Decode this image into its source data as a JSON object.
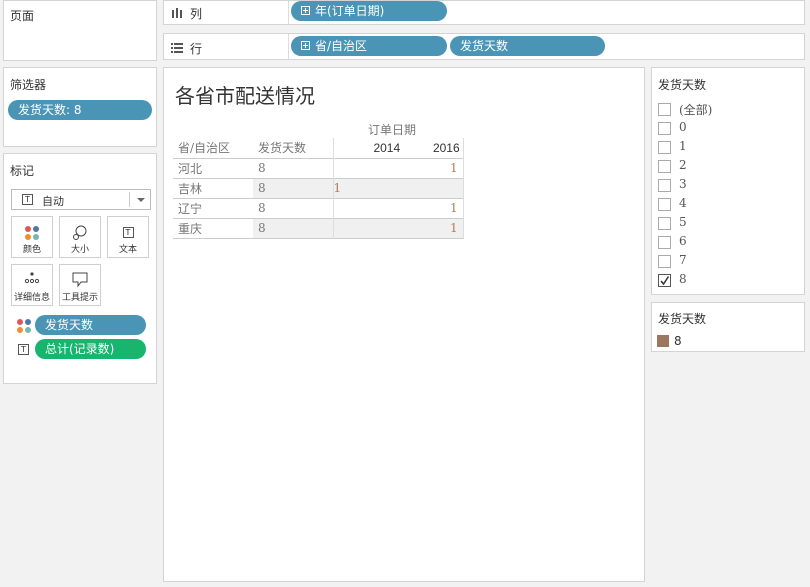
{
  "pages_shelf": {
    "title": "页面"
  },
  "columns_shelf": {
    "icon": "columns-icon",
    "label": "列",
    "pills": [
      "年(订单日期)"
    ]
  },
  "rows_shelf": {
    "icon": "rows-icon",
    "label": "行",
    "pills": [
      "省/自治区",
      "发货天数"
    ]
  },
  "filters_shelf": {
    "title": "筛选器",
    "pills": [
      "发货天数: 8"
    ]
  },
  "marks": {
    "title": "标记",
    "type_value": "自动",
    "buttons": [
      "颜色",
      "大小",
      "文本",
      "详细信息",
      "工具提示"
    ],
    "fields": [
      "发货天数",
      "总计(记录数)"
    ]
  },
  "view": {
    "title": "各省市配送情况",
    "column_header_label": "订单日期",
    "row_headers": [
      "省/自治区",
      "发货天数"
    ],
    "years": [
      "2014",
      "2016"
    ],
    "rows": [
      {
        "province": "河北",
        "days": "8",
        "y2014": "",
        "y2016": "1"
      },
      {
        "province": "吉林",
        "days": "8",
        "y2014": "1",
        "y2016": ""
      },
      {
        "province": "辽宁",
        "days": "8",
        "y2014": "",
        "y2016": "1"
      },
      {
        "province": "重庆",
        "days": "8",
        "y2014": "",
        "y2016": "1"
      }
    ]
  },
  "filter_card": {
    "title": "发货天数",
    "options": [
      {
        "label": "(全部)",
        "checked": false
      },
      {
        "label": "0",
        "checked": false
      },
      {
        "label": "1",
        "checked": false
      },
      {
        "label": "2",
        "checked": false
      },
      {
        "label": "3",
        "checked": false
      },
      {
        "label": "4",
        "checked": false
      },
      {
        "label": "5",
        "checked": false
      },
      {
        "label": "6",
        "checked": false
      },
      {
        "label": "7",
        "checked": false
      },
      {
        "label": "8",
        "checked": true
      }
    ]
  },
  "legend_card": {
    "title": "发货天数",
    "items": [
      {
        "label": "8",
        "color": "#9d7660"
      }
    ]
  },
  "colors": {
    "pill_blue": "#4a95b6",
    "pill_green": "#17b56e",
    "mark_value": "#b07a5e"
  }
}
